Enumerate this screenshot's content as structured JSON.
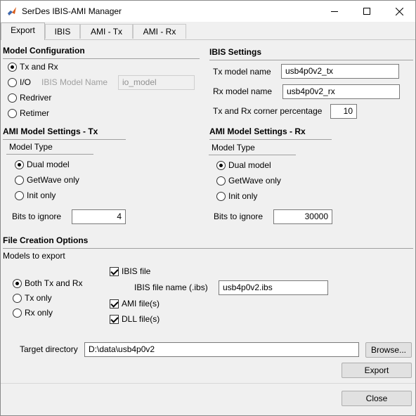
{
  "window": {
    "title": "SerDes IBIS-AMI Manager"
  },
  "tabs": [
    "Export",
    "IBIS",
    "AMI - Tx",
    "AMI - Rx"
  ],
  "model_configuration": {
    "heading": "Model Configuration",
    "options": [
      "Tx and Rx",
      "I/O",
      "Redriver",
      "Retimer"
    ],
    "selected": "Tx and Rx",
    "ibis_model_name_label": "IBIS Model Name",
    "ibis_model_name_value": "io_model"
  },
  "ibis_settings": {
    "heading": "IBIS Settings",
    "tx_label": "Tx model name",
    "tx_value": "usb4p0v2_tx",
    "rx_label": "Rx model name",
    "rx_value": "usb4p0v2_rx",
    "corner_label": "Tx and Rx corner percentage",
    "corner_value": "10"
  },
  "ami_tx": {
    "heading": "AMI Model Settings - Tx",
    "model_type_label": "Model Type",
    "options": [
      "Dual model",
      "GetWave only",
      "Init only"
    ],
    "selected": "Dual model",
    "bits_label": "Bits to ignore",
    "bits_value": "4"
  },
  "ami_rx": {
    "heading": "AMI Model Settings - Rx",
    "model_type_label": "Model Type",
    "options": [
      "Dual model",
      "GetWave only",
      "Init only"
    ],
    "selected": "Dual model",
    "bits_label": "Bits to ignore",
    "bits_value": "30000"
  },
  "file_creation": {
    "heading": "File Creation Options",
    "models_to_export_label": "Models to export",
    "export_options": [
      "Both Tx and Rx",
      "Tx only",
      "Rx only"
    ],
    "export_selected": "Both Tx and Rx",
    "ibis_file_label": "IBIS file",
    "ibis_file_checked": true,
    "ibis_file_name_label": "IBIS file name (.ibs)",
    "ibis_file_name_value": "usb4p0v2.ibs",
    "ami_files_label": "AMI file(s)",
    "ami_files_checked": true,
    "dll_files_label": "DLL file(s)",
    "dll_files_checked": true,
    "target_directory_label": "Target directory",
    "target_directory_value": "D:\\data\\usb4p0v2",
    "browse_label": "Browse...",
    "export_label": "Export"
  },
  "close_label": "Close"
}
